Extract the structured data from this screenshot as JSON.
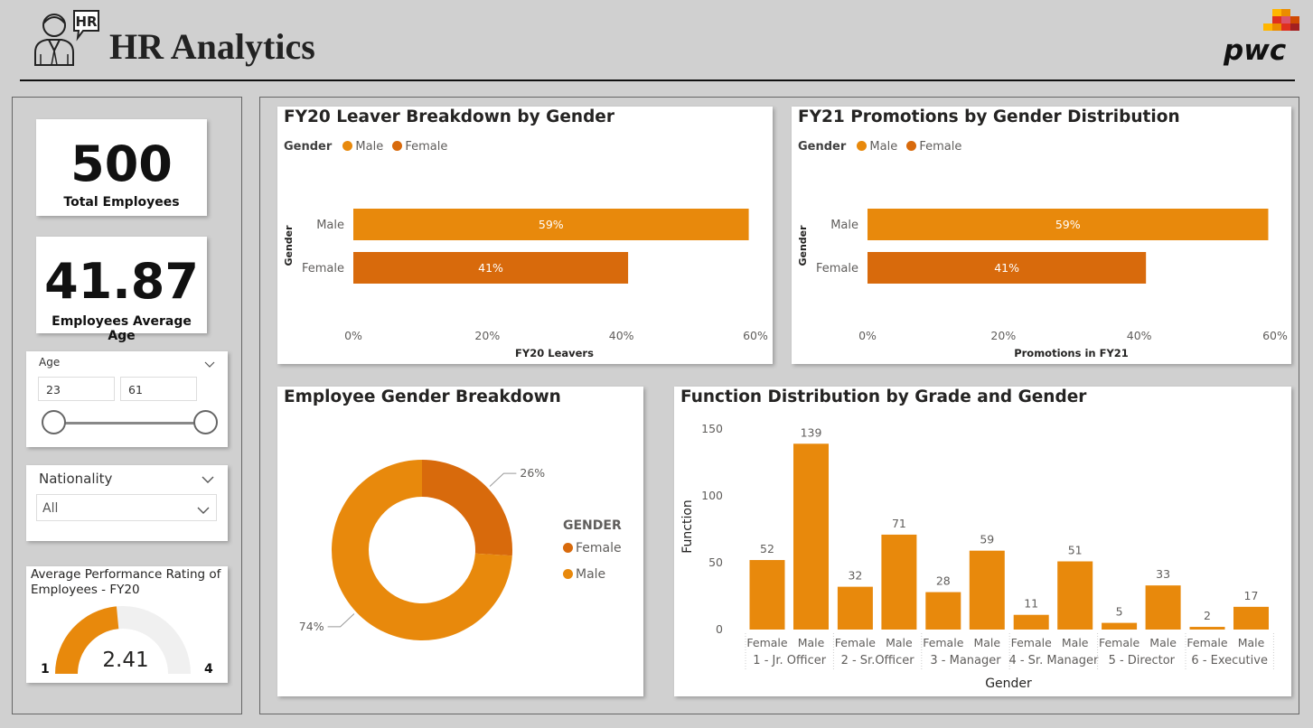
{
  "header": {
    "title": "HR Analytics",
    "logo_text": "pwc",
    "hr_icon_text": "HR"
  },
  "kpis": [
    {
      "value": "500",
      "label": "Total Employees"
    },
    {
      "value": "41.87",
      "label": "Employees Average Age"
    }
  ],
  "age_slicer": {
    "label": "Age",
    "min": "23",
    "max": "61"
  },
  "nationality_slicer": {
    "label": "Nationality",
    "selected": "All"
  },
  "gauge": {
    "title": "Average Performance Rating of Employees - FY20",
    "value": "2.41",
    "min": "1",
    "max": "4"
  },
  "colors": {
    "male": "#E8890C",
    "female": "#D86A0C",
    "gauge_bg": "#F0F0F0"
  },
  "chart_data": [
    {
      "type": "bar",
      "orientation": "horizontal",
      "title": "FY20 Leaver Breakdown by Gender",
      "legend_title": "Gender",
      "legend": [
        "Male",
        "Female"
      ],
      "categories": [
        "Male",
        "Female"
      ],
      "values": [
        0.59,
        0.41
      ],
      "data_labels": [
        "59%",
        "41%"
      ],
      "xlabel": "FY20 Leavers",
      "ylabel": "Gender",
      "xticks": [
        "0%",
        "20%",
        "40%",
        "60%"
      ],
      "xlim": [
        0,
        0.6
      ]
    },
    {
      "type": "bar",
      "orientation": "horizontal",
      "title": "FY21 Promotions by Gender Distribution",
      "legend_title": "Gender",
      "legend": [
        "Male",
        "Female"
      ],
      "categories": [
        "Male",
        "Female"
      ],
      "values": [
        0.59,
        0.41
      ],
      "data_labels": [
        "59%",
        "41%"
      ],
      "xlabel": "Promotions in FY21",
      "ylabel": "Gender",
      "xticks": [
        "0%",
        "20%",
        "40%",
        "60%"
      ],
      "xlim": [
        0,
        0.6
      ]
    },
    {
      "type": "pie",
      "donut": true,
      "title": "Employee Gender Breakdown",
      "legend_title": "GENDER",
      "legend": [
        "Female",
        "Male"
      ],
      "categories": [
        "Female",
        "Male"
      ],
      "values": [
        0.26,
        0.74
      ],
      "data_labels": [
        "26%",
        "74%"
      ]
    },
    {
      "type": "bar",
      "title": "Function Distribution by Grade and Gender",
      "xlabel": "Gender",
      "ylabel": "Function",
      "ylim": [
        0,
        150
      ],
      "yticks": [
        "0",
        "50",
        "100",
        "150"
      ],
      "groups": [
        "1 - Jr. Officer",
        "2 - Sr.Officer",
        "3 - Manager",
        "4 - Sr. Manager",
        "5 - Director",
        "6 - Executive"
      ],
      "categories": [
        "Female",
        "Male"
      ],
      "values": [
        [
          52,
          139
        ],
        [
          32,
          71
        ],
        [
          28,
          59
        ],
        [
          11,
          51
        ],
        [
          5,
          33
        ],
        [
          2,
          17
        ]
      ]
    }
  ]
}
